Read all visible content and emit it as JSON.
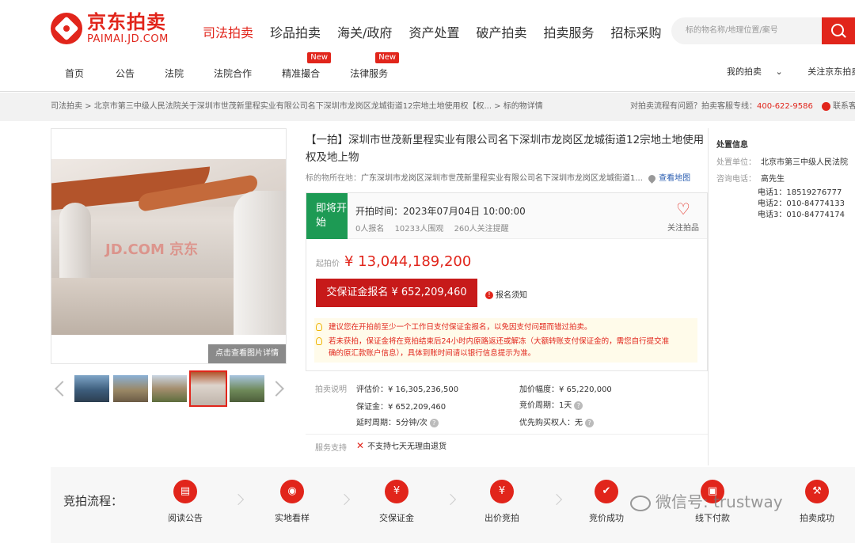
{
  "brand": {
    "cn": "京东拍卖",
    "en": "PAIMAI.JD.COM",
    "color": "#e1251b"
  },
  "main_nav": [
    "司法拍卖",
    "珍品拍卖",
    "海关/政府",
    "资产处置",
    "破产拍卖",
    "拍卖服务",
    "招标采购"
  ],
  "search": {
    "placeholder": "标的物名称/地理位置/案号"
  },
  "sub_nav": [
    {
      "label": "首页",
      "badge": ""
    },
    {
      "label": "公告",
      "badge": ""
    },
    {
      "label": "法院",
      "badge": ""
    },
    {
      "label": "法院合作",
      "badge": ""
    },
    {
      "label": "精准撮合",
      "badge": "New"
    },
    {
      "label": "法律服务",
      "badge": "New"
    }
  ],
  "header_right": {
    "my_auction": "我的拍卖",
    "follow": "关注京东拍卖"
  },
  "breadcrumb": {
    "path": "司法拍卖 > 北京市第三中级人民法院关于深圳市世茂新里程实业有限公司名下深圳市龙岗区龙城街道12宗地土地使用权【权... > 标的物详情",
    "question": "对拍卖流程有问题？拍卖客服专线：",
    "phone": "400-622-9586",
    "contact": "联系客服"
  },
  "gallery": {
    "view_button": "点击查看图片详情",
    "watermark": "JD.COM 京东"
  },
  "item": {
    "title": "【一拍】深圳市世茂新里程实业有限公司名下深圳市龙岗区龙城街道12宗地土地使用权及地上物",
    "location_label": "标的物所在地：",
    "location_value": "广东深圳市龙岗区深圳市世茂新里程实业有限公司名下深圳市龙岗区龙城街道1...",
    "map_link": "查看地图"
  },
  "auction": {
    "status": "即将开始",
    "status_color": "#1d9a54",
    "start_time": "开拍时间：2023年07月04日 10:00:00",
    "signups": "0人报名",
    "watchers": "10233人围观",
    "reminders": "260人关注提醒",
    "follow_label": "关注拍品",
    "price_label": "起拍价",
    "price": "¥ 13,044,189,200",
    "deposit_button": "交保证金报名 ¥ 652,209,460",
    "notice": "报名须知",
    "tip1": "建议您在开拍前至少一个工作日支付保证金报名，以免因支付问题而错过拍卖。",
    "tip2a": "若未获拍，保证金将在竞拍结束后24小时内原路返还或解冻（大额转账支付保证金的，需您自行提交准",
    "tip2b": "确的原汇款账户信息），具体到账时间请以银行信息提示为准。"
  },
  "details": {
    "section_label": "拍卖说明",
    "appraisal": "评估价：¥ 16,305,236,500",
    "increment": "加价幅度：¥ 65,220,000",
    "deposit": "保证金：¥ 652,209,460",
    "cycle": "竞价周期：1天",
    "extension": "延时周期：5分钟/次",
    "priority": "优先购买权人：无",
    "service_label": "服务支持",
    "service_value": "不支持七天无理由退货"
  },
  "side": {
    "title": "处置信息",
    "unit_label": "处置单位：",
    "unit_value": "北京市第三中级人民法院",
    "contact_label": "咨询电话：",
    "contact_name": "高先生",
    "phones": [
      "电话1：18519276777",
      "电话2：010-84774133",
      "电话3：010-84774174"
    ]
  },
  "process": {
    "title": "竞拍流程：",
    "steps": [
      "阅读公告",
      "实地看样",
      "交保证金",
      "出价竞拍",
      "竞价成功",
      "线下付款",
      "拍卖成功"
    ]
  },
  "overlay_watermark": "微信号: trustway"
}
